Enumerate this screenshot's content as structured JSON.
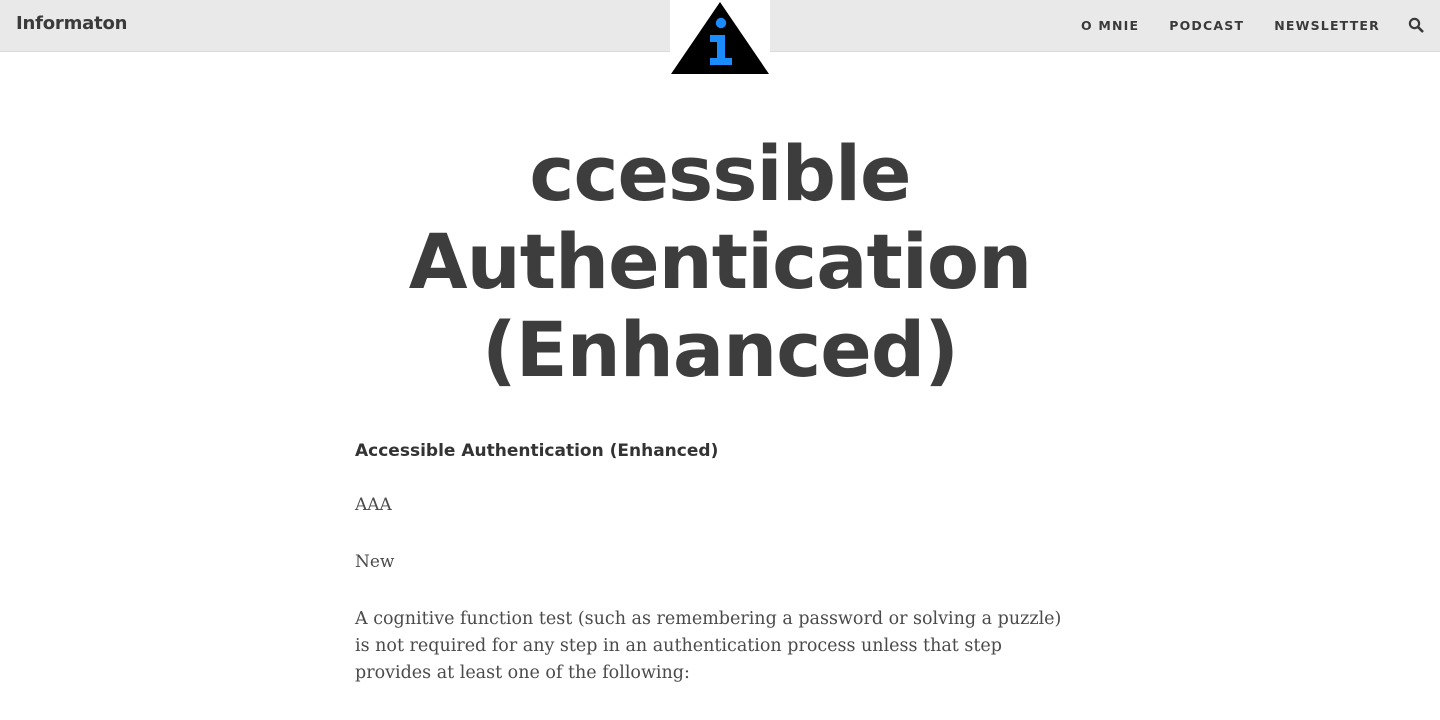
{
  "header": {
    "site_title": "Informaton",
    "nav": [
      {
        "label": "O MNIE"
      },
      {
        "label": "PODCAST"
      },
      {
        "label": "NEWSLETTER"
      }
    ],
    "search_icon": "search-icon",
    "logo": {
      "icon": "info-triangle-logo",
      "glyph": "i",
      "colors": {
        "triangle": "#000000",
        "glyph": "#1a8cff"
      }
    }
  },
  "article": {
    "title_lines": [
      "ccessible",
      "Authentication",
      "(Enhanced)"
    ],
    "subheading": "Accessible Authentication (Enhanced)",
    "level": "AAA",
    "status": "New",
    "body": "A cognitive function test (such as remembering a password or solving a puzzle) is not required for any step in an authentication process unless that step provides at least one of the following:"
  },
  "colors": {
    "topbar_bg": "#e9e9e9",
    "text": "#3f3f3f",
    "accent": "#1a8cff"
  }
}
